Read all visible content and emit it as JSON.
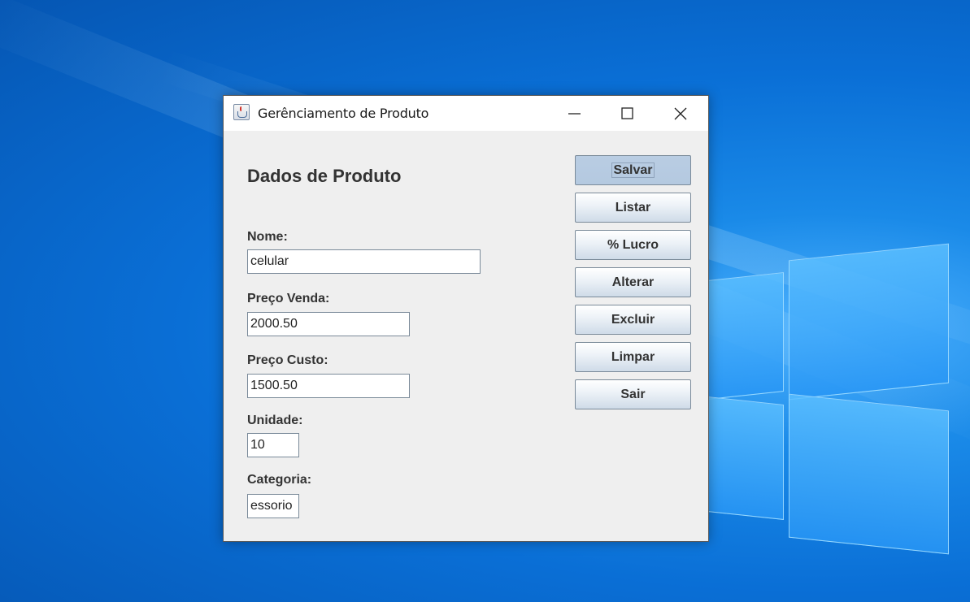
{
  "window": {
    "title": "Gerênciamento de Produto"
  },
  "form": {
    "heading": "Dados de Produto",
    "fields": [
      {
        "label": "Nome:",
        "value": "celular"
      },
      {
        "label": "Preço Venda:",
        "value": "2000.50"
      },
      {
        "label": "Preço Custo:",
        "value": "1500.50"
      },
      {
        "label": "Unidade:",
        "value": "10"
      },
      {
        "label": "Categoria:",
        "value": "essorio"
      }
    ]
  },
  "actions": [
    {
      "label": "Salvar",
      "state": "pressed"
    },
    {
      "label": "Listar"
    },
    {
      "label": "% Lucro"
    },
    {
      "label": "Alterar"
    },
    {
      "label": "Excluir"
    },
    {
      "label": "Limpar"
    },
    {
      "label": "Sair"
    }
  ],
  "icons": {
    "app": "java-coffee-icon",
    "minimize": "minimize-icon",
    "maximize": "maximize-icon",
    "close": "close-icon"
  }
}
